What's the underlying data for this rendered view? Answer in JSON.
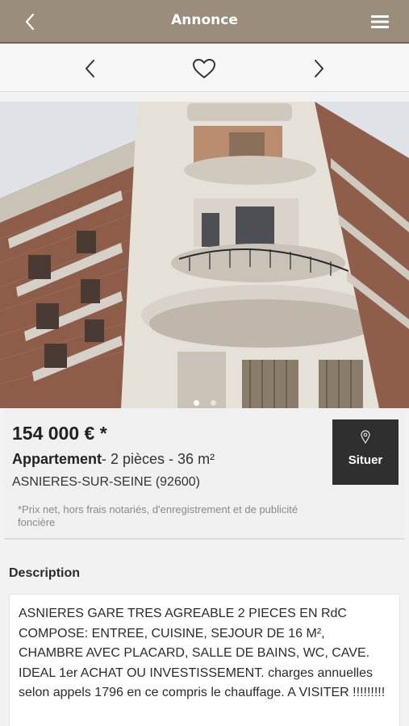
{
  "header": {
    "title": "Annonce",
    "back_icon": "chevron-left-icon",
    "menu_icon": "hamburger-menu-icon",
    "background_color": "#9b8d7b"
  },
  "navigation": {
    "previous_icon": "chevron-left-icon",
    "favorite_icon": "heart-outline-icon",
    "next_icon": "chevron-right-icon"
  },
  "gallery": {
    "image": "photo of a brick and stone apartment building with curved balconies",
    "slide_count": 2,
    "active_slide": 1
  },
  "listing": {
    "price": "154 000 € *",
    "type": "Appartement",
    "details": "- 2 pièces - 36 m²",
    "city": "ASNIERES-SUR-SEINE (92600)",
    "price_note": "*Prix net, hors frais notariés, d'enregistrement et de publicité foncière",
    "locate_button": "Situer",
    "locate_icon": "map-pin-icon"
  },
  "description": {
    "title": "Description",
    "text": "ASNIERES GARE TRES AGREABLE 2 PIECES EN RdC COMPOSE: ENTREE, CUISINE, SEJOUR DE 16 M², CHAMBRE AVEC PLACARD, SALLE DE BAINS, WC, CAVE. IDEAL 1er ACHAT OU INVESTISSEMENT. charges annuelles selon appels 1796 en ce compris le chauffage. A VISITER !!!!!!!!!"
  }
}
